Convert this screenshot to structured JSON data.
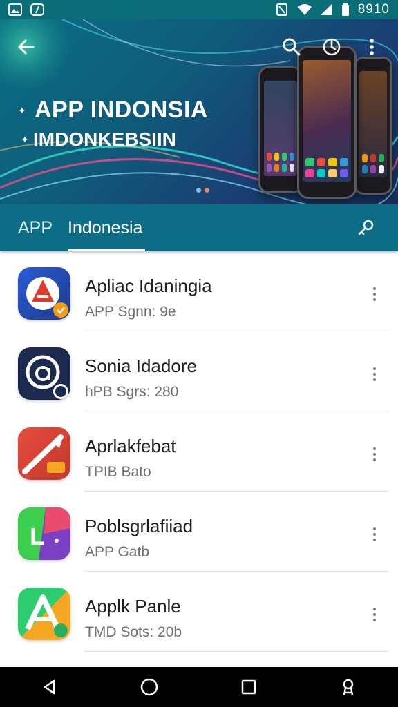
{
  "status_bar": {
    "time": "8910",
    "left_icons": [
      "image-icon",
      "clock-icon"
    ],
    "right_icons": [
      "nfc-icon",
      "wifi-icon",
      "signal-icon",
      "battery-icon"
    ]
  },
  "header": {
    "title": "APP INDONSIA",
    "subtitle": "IMDONKEBSIIN",
    "toolbar_icons": [
      "back-arrow-icon",
      "search-icon",
      "globe-icon",
      "more-vert-icon"
    ],
    "carousel_dots": 2,
    "colors": {
      "primary": "#0e6d86",
      "status_bar": "#0a6d78"
    }
  },
  "tabs": [
    {
      "label": "APP",
      "active": false
    },
    {
      "label": "Indonesia",
      "active": true
    }
  ],
  "tab_action_icon": "key-icon",
  "apps": [
    {
      "name": "Apliac Idaningia",
      "meta": "APP Sgnn: 9e",
      "icon": "letter-a-red-blue-icon"
    },
    {
      "name": "Sonia Idadore",
      "meta": "hPB Sgrs: 280",
      "icon": "letter-a-circle-navy-icon"
    },
    {
      "name": "Aprlakfebat",
      "meta": "TPIB Bato",
      "icon": "red-slash-icon"
    },
    {
      "name": "Poblsgrlafiiad",
      "meta": "APP Gatb",
      "icon": "green-purple-pie-icon"
    },
    {
      "name": "Applk Panle",
      "meta": "TMD Sots: 20b",
      "icon": "letter-a-green-orange-icon"
    }
  ],
  "nav_icons": [
    "back-triangle-icon",
    "home-circle-icon",
    "recents-square-icon",
    "account-icon"
  ]
}
